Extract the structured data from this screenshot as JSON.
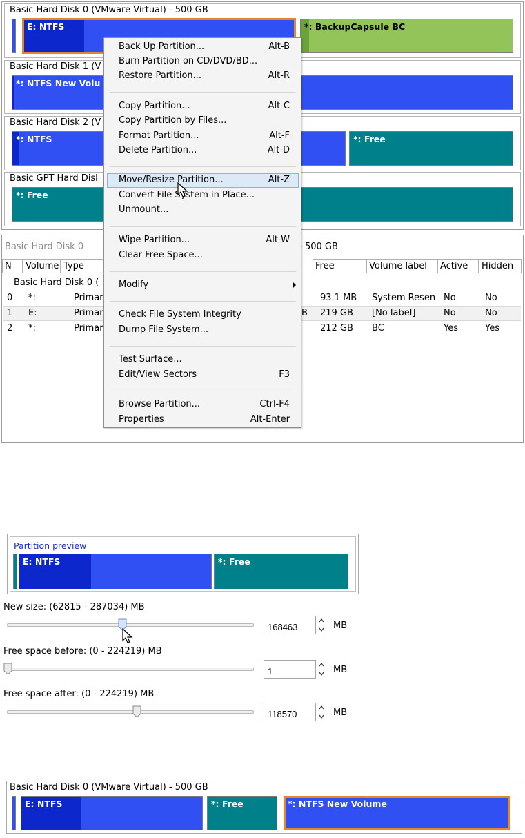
{
  "disk_map": {
    "disks": [
      {
        "title": "Basic Hard Disk 0 (VMware Virtual) - 500 GB",
        "partitions": [
          {
            "label": "E: NTFS"
          },
          {
            "label": "*: BackupCapsule BC"
          }
        ]
      },
      {
        "title": "Basic Hard Disk 1 (V",
        "partitions": [
          {
            "label": "*: NTFS New Volu"
          }
        ]
      },
      {
        "title": "Basic Hard Disk 2 (V",
        "partitions": [
          {
            "label": "*: NTFS"
          },
          {
            "label": "*: Free"
          }
        ]
      },
      {
        "title": "Basic GPT Hard Disl",
        "partitions": [
          {
            "label": "*: Free"
          }
        ]
      }
    ]
  },
  "list_panel": {
    "caption": "Basic Hard Disk 0",
    "size_text": "ze 500 GB",
    "columns": [
      "N",
      "Volume",
      "Type",
      "Free",
      "Volume label",
      "Active",
      "Hidden"
    ],
    "group_label": "Basic Hard Disk 0 (",
    "rows": [
      {
        "n": "0",
        "volume": "*:",
        "type": "Primar",
        "used_frag": "",
        "free": "93.1 MB",
        "label": "System Resen",
        "active": "No",
        "hidden": "No"
      },
      {
        "n": "1",
        "volume": "E:",
        "type": "Primar",
        "used_frag": "B",
        "free": "219 GB",
        "label": "[No label]",
        "active": "No",
        "hidden": "No"
      },
      {
        "n": "2",
        "volume": "*:",
        "type": "Primar",
        "used_frag": "",
        "free": "212 GB",
        "label": "BC",
        "active": "Yes",
        "hidden": "Yes"
      }
    ]
  },
  "context_menu": {
    "items": [
      {
        "label": "Back Up Partition...",
        "shortcut": "Alt-B"
      },
      {
        "label": "Burn Partition on CD/DVD/BD...",
        "shortcut": ""
      },
      {
        "label": "Restore Partition...",
        "shortcut": "Alt-R"
      },
      {
        "label": "Copy Partition...",
        "shortcut": "Alt-C"
      },
      {
        "label": "Copy Partition by Files...",
        "shortcut": ""
      },
      {
        "label": "Format Partition...",
        "shortcut": "Alt-F"
      },
      {
        "label": "Delete Partition...",
        "shortcut": "Alt-D"
      },
      {
        "label": "Move/Resize Partition...",
        "shortcut": "Alt-Z"
      },
      {
        "label": "Convert File System in Place...",
        "shortcut": ""
      },
      {
        "label": "Unmount...",
        "shortcut": ""
      },
      {
        "label": "Wipe Partition...",
        "shortcut": "Alt-W"
      },
      {
        "label": "Clear Free Space...",
        "shortcut": ""
      },
      {
        "label": "Modify",
        "shortcut": ""
      },
      {
        "label": "Check File System Integrity",
        "shortcut": ""
      },
      {
        "label": "Dump File System...",
        "shortcut": ""
      },
      {
        "label": "Test Surface...",
        "shortcut": ""
      },
      {
        "label": "Edit/View Sectors",
        "shortcut": "F3"
      },
      {
        "label": "Browse Partition...",
        "shortcut": "Ctrl-F4"
      },
      {
        "label": "Properties",
        "shortcut": "Alt-Enter"
      }
    ],
    "highlighted": "Move/Resize Partition..."
  },
  "resize_panel": {
    "preview_title": "Partition preview",
    "preview_partitions": [
      {
        "label": "E: NTFS"
      },
      {
        "label": "*: Free"
      }
    ],
    "new_size": {
      "label": "New size: (62815 - 287034) MB",
      "value": "168463",
      "unit": "MB",
      "slider_fraction": 0.47
    },
    "free_before": {
      "label": "Free space before: (0 - 224219) MB",
      "value": "1",
      "unit": "MB",
      "slider_fraction": 0.0
    },
    "free_after": {
      "label": "Free space after: (0 - 224219) MB",
      "value": "118570",
      "unit": "MB",
      "slider_fraction": 0.53
    }
  },
  "result_disk": {
    "title": "Basic Hard Disk 0 (VMware Virtual) - 500 GB",
    "partitions": [
      {
        "label": "E: NTFS"
      },
      {
        "label": "*: Free"
      },
      {
        "label": "*: NTFS New Volume"
      }
    ]
  },
  "colors": {
    "partition_blue": "#3050f4",
    "used_blue": "#0c28cc",
    "free_teal": "#00808a",
    "backup_green": "#92c45a",
    "selection_orange": "#e3872d",
    "menu_highlight": "#dce9f7"
  }
}
